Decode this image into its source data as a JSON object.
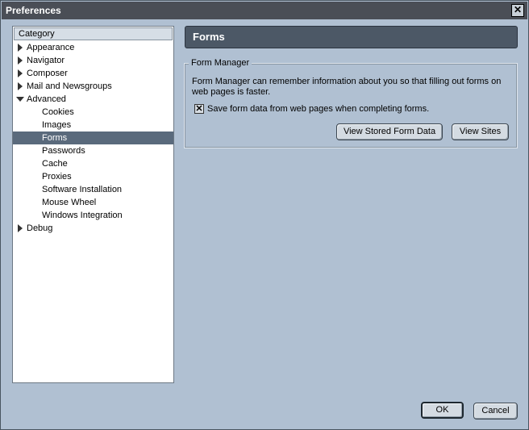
{
  "window": {
    "title": "Preferences",
    "close_glyph": "✕"
  },
  "tree": {
    "header": "Category",
    "items": [
      {
        "label": "Appearance",
        "twisty": "closed"
      },
      {
        "label": "Navigator",
        "twisty": "closed"
      },
      {
        "label": "Composer",
        "twisty": "closed"
      },
      {
        "label": "Mail and Newsgroups",
        "twisty": "closed"
      },
      {
        "label": "Advanced",
        "twisty": "open"
      },
      {
        "label": "Cookies"
      },
      {
        "label": "Images"
      },
      {
        "label": "Forms",
        "selected": true
      },
      {
        "label": "Passwords"
      },
      {
        "label": "Cache"
      },
      {
        "label": "Proxies"
      },
      {
        "label": "Software Installation"
      },
      {
        "label": "Mouse Wheel"
      },
      {
        "label": "Windows Integration"
      },
      {
        "label": "Debug",
        "twisty": "closed"
      }
    ]
  },
  "panel": {
    "title": "Forms",
    "group": {
      "legend": "Form Manager",
      "description": "Form Manager can remember information about you so that filling out forms on web pages is faster.",
      "checkbox_label": "Save form data from web pages when completing forms.",
      "checkbox_checked": true,
      "check_glyph": "✕",
      "view_stored_label": "View Stored Form Data",
      "view_sites_label": "View Sites"
    }
  },
  "buttons": {
    "ok": "OK",
    "cancel": "Cancel"
  },
  "colors": {
    "window_bg": "#b0c0d2",
    "titlebar": "#4a4e56",
    "panel_header": "#4c5866",
    "selection": "#5a6a7c"
  }
}
